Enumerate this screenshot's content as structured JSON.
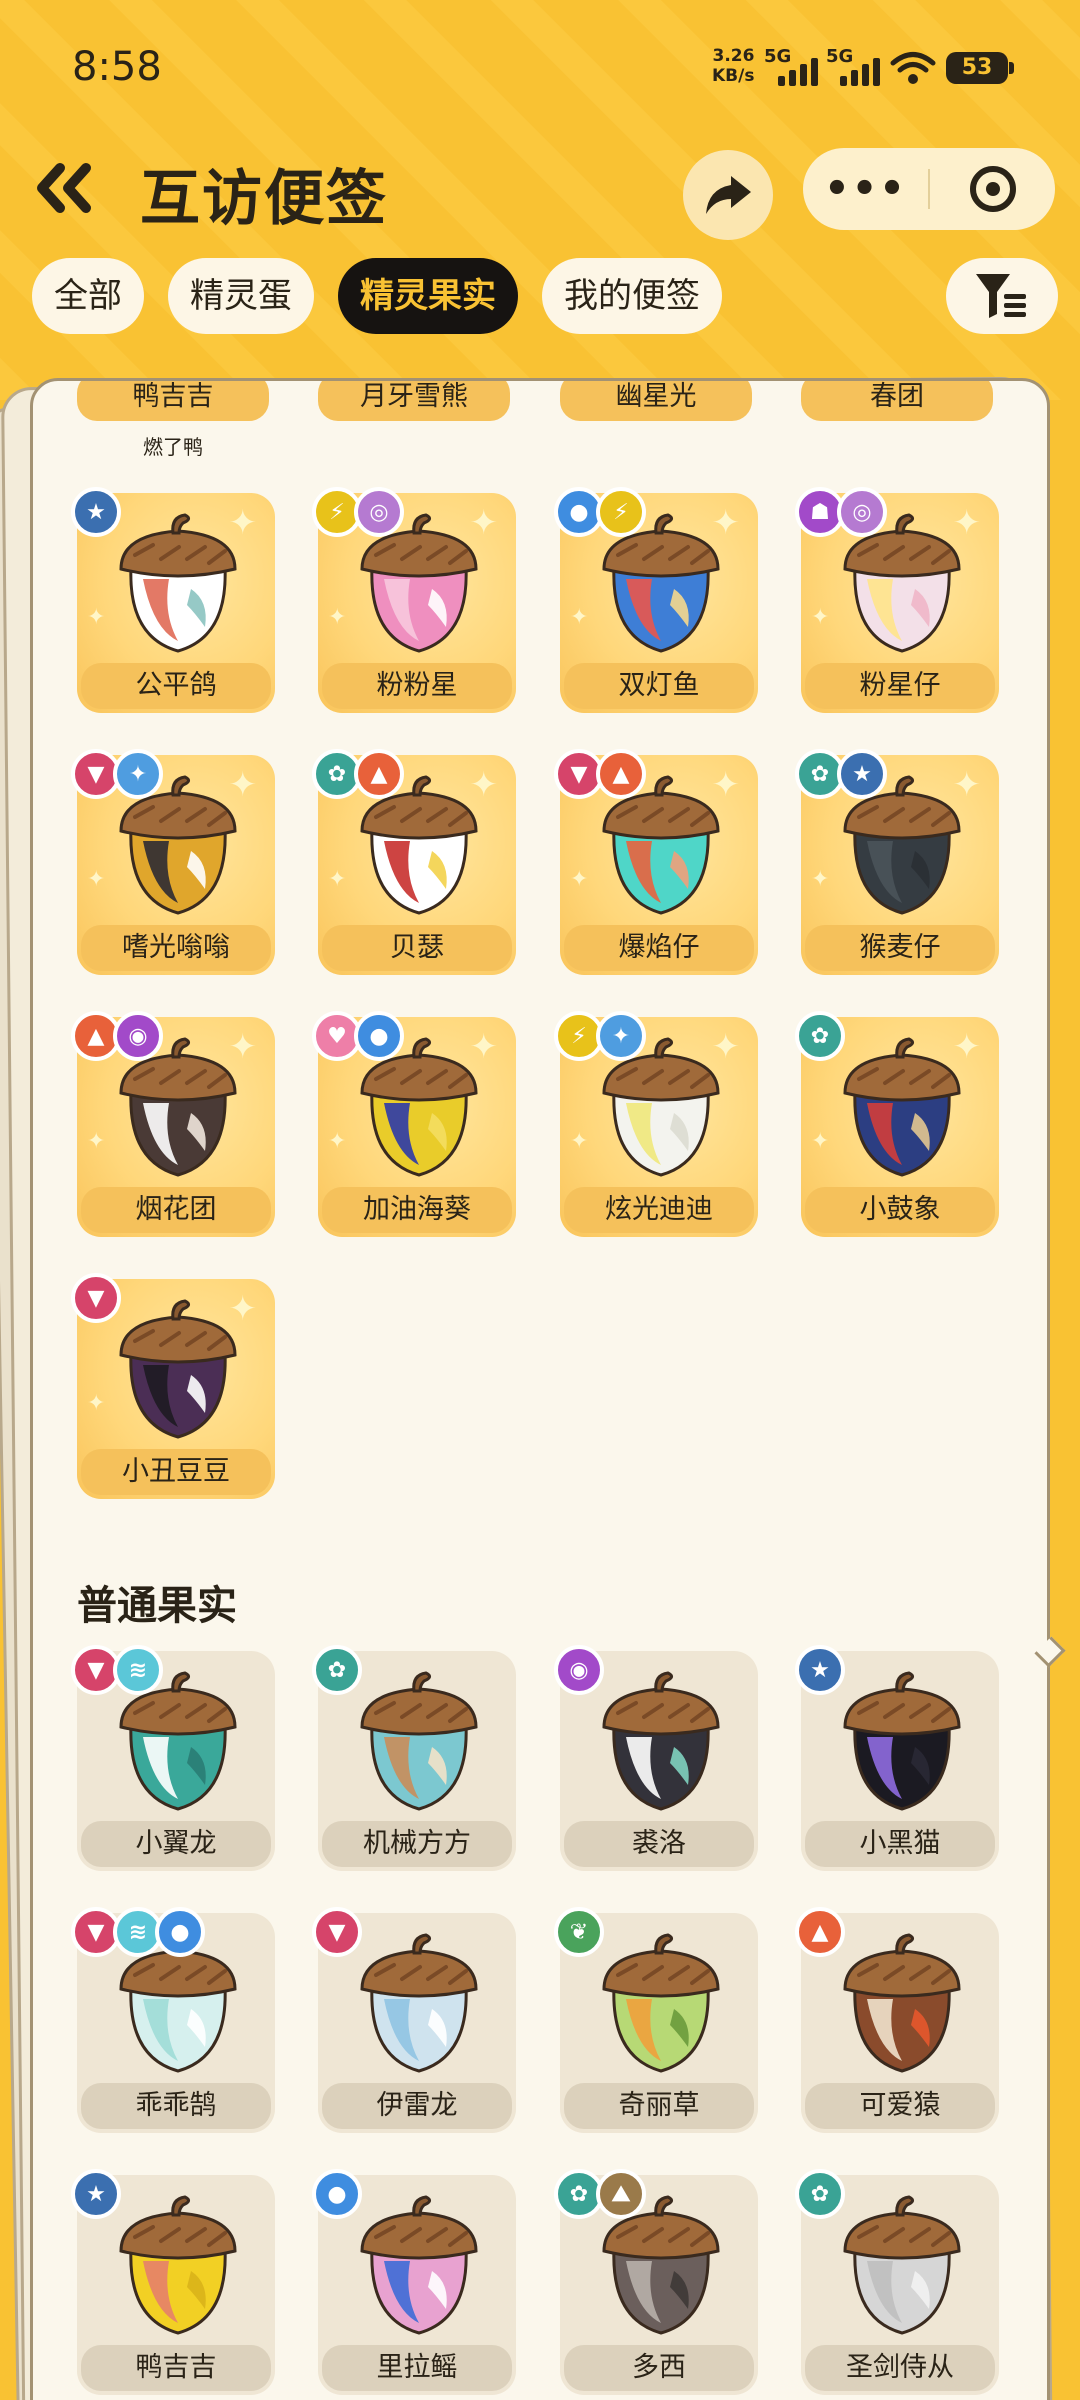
{
  "status_bar": {
    "time": "8:58",
    "net_speed_value": "3.26",
    "net_speed_unit": "KB/s",
    "sim1": "5G",
    "sim2": "5G",
    "battery": "53"
  },
  "header": {
    "title": "互访便签",
    "more_label": "•••",
    "icons": {
      "back": "double-chevron-left-icon",
      "share": "share-arrow-icon",
      "close": "target-close-icon"
    }
  },
  "tabs": [
    {
      "label": "全部",
      "active": false
    },
    {
      "label": "精灵蛋",
      "active": false
    },
    {
      "label": "精灵果实",
      "active": true
    },
    {
      "label": "我的便签",
      "active": false
    }
  ],
  "top_row": {
    "names": [
      "鸭吉吉",
      "月牙雪熊",
      "幽星光",
      "春团"
    ],
    "owner": "燃了鸭"
  },
  "special_fruits": [
    {
      "name": "公平鸽",
      "badges": [
        {
          "icon": "star-icon",
          "color": "#3b6fb0"
        }
      ],
      "colors": [
        "#ffffff",
        "#e06a55",
        "#8bc3c0"
      ]
    },
    {
      "name": "粉粉星",
      "badges": [
        {
          "icon": "lightning-icon",
          "color": "#e8c21a"
        },
        {
          "icon": "spiral-icon",
          "color": "#b57ad1"
        }
      ],
      "colors": [
        "#ef8fbf",
        "#f7c8dd",
        "#ffffff"
      ]
    },
    {
      "name": "双灯鱼",
      "badges": [
        {
          "icon": "water-drop-icon",
          "color": "#3f8de0"
        },
        {
          "icon": "lightning-icon",
          "color": "#e8c21a"
        }
      ],
      "colors": [
        "#3e7ed6",
        "#e9564c",
        "#f5d88d"
      ]
    },
    {
      "name": "粉星仔",
      "badges": [
        {
          "icon": "ghost-icon",
          "color": "#a24ac9"
        },
        {
          "icon": "spiral-icon",
          "color": "#b57ad1"
        }
      ],
      "colors": [
        "#f3e0e8",
        "#ffe48a",
        "#f0b6c8"
      ]
    },
    {
      "name": "嗜光嗡嗡",
      "badges": [
        {
          "icon": "demon-icon",
          "color": "#d6446a"
        },
        {
          "icon": "sparkle-icon",
          "color": "#4f9de0"
        }
      ],
      "colors": [
        "#e0a62c",
        "#2d2b33",
        "#ffffff"
      ]
    },
    {
      "name": "贝瑟",
      "badges": [
        {
          "icon": "gear-icon",
          "color": "#3aa395"
        },
        {
          "icon": "fire-icon",
          "color": "#e8613a"
        }
      ],
      "colors": [
        "#ffffff",
        "#c8302e",
        "#f3d24a"
      ]
    },
    {
      "name": "爆焰仔",
      "badges": [
        {
          "icon": "demon-icon",
          "color": "#d6446a"
        },
        {
          "icon": "fire-icon",
          "color": "#e8613a"
        }
      ],
      "colors": [
        "#4fd6c8",
        "#e8633e",
        "#f0a07a"
      ]
    },
    {
      "name": "猴麦仔",
      "badges": [
        {
          "icon": "gear-icon",
          "color": "#3aa395"
        },
        {
          "icon": "star-icon",
          "color": "#3b6fb0"
        }
      ],
      "colors": [
        "#353c42",
        "#4a535a",
        "#2a2f34"
      ]
    },
    {
      "name": "烟花团",
      "badges": [
        {
          "icon": "fire-icon",
          "color": "#e8613a"
        },
        {
          "icon": "search-swirl-icon",
          "color": "#a24ac9"
        }
      ],
      "colors": [
        "#4a3a36",
        "#ffffff",
        "#f0e6dc"
      ]
    },
    {
      "name": "加油海葵",
      "badges": [
        {
          "icon": "heart-icon",
          "color": "#ee7fa8"
        },
        {
          "icon": "water-drop-icon",
          "color": "#3f8de0"
        }
      ],
      "colors": [
        "#e9cc2a",
        "#2c3aa8",
        "#f4de60"
      ]
    },
    {
      "name": "炫光迪迪",
      "badges": [
        {
          "icon": "lightning-icon",
          "color": "#e8c21a"
        },
        {
          "icon": "sparkle-icon",
          "color": "#4f9de0"
        }
      ],
      "colors": [
        "#f3f3ee",
        "#f0e87a",
        "#dcdcd0"
      ]
    },
    {
      "name": "小鼓象",
      "badges": [
        {
          "icon": "gear-icon",
          "color": "#3aa395"
        }
      ],
      "colors": [
        "#2c3e82",
        "#d23d3a",
        "#e3c690"
      ]
    },
    {
      "name": "小丑豆豆",
      "badges": [
        {
          "icon": "demon-icon",
          "color": "#d6446a"
        }
      ],
      "colors": [
        "#4b2e55",
        "#1e1b22",
        "#ffffff"
      ]
    }
  ],
  "normal_section": {
    "title": "普通果实",
    "fruits": [
      {
        "name": "小翼龙",
        "badges": [
          {
            "icon": "demon-icon",
            "color": "#d6446a"
          },
          {
            "icon": "wind-icon",
            "color": "#5bc7d8"
          }
        ],
        "colors": [
          "#3aa89a",
          "#ffffff",
          "#2a7c74"
        ]
      },
      {
        "name": "机械方方",
        "badges": [
          {
            "icon": "gear-icon",
            "color": "#3aa395"
          }
        ],
        "colors": [
          "#7cc8d0",
          "#c98d5a",
          "#f2e2c8"
        ]
      },
      {
        "name": "裘洛",
        "badges": [
          {
            "icon": "search-swirl-icon",
            "color": "#a24ac9"
          }
        ],
        "colors": [
          "#33323a",
          "#ffffff",
          "#7fd2c0"
        ]
      },
      {
        "name": "小黑猫",
        "badges": [
          {
            "icon": "star-icon",
            "color": "#3b6fb0"
          }
        ],
        "colors": [
          "#1b1a22",
          "#8f6be0",
          "#2a2935"
        ]
      },
      {
        "name": "乖乖鹄",
        "badges": [
          {
            "icon": "demon-icon",
            "color": "#d6446a"
          },
          {
            "icon": "wind-icon",
            "color": "#5bc7d8"
          },
          {
            "icon": "water-drop-icon",
            "color": "#3f8de0"
          }
        ],
        "colors": [
          "#d6f0ee",
          "#9fdcd6",
          "#ffffff"
        ]
      },
      {
        "name": "伊雷龙",
        "badges": [
          {
            "icon": "demon-icon",
            "color": "#d6446a"
          }
        ],
        "colors": [
          "#cfe3ee",
          "#8fc3e2",
          "#ffffff"
        ]
      },
      {
        "name": "奇丽草",
        "badges": [
          {
            "icon": "leaf-icon",
            "color": "#4aa35c"
          }
        ],
        "colors": [
          "#b7d975",
          "#f0a03c",
          "#6a9a3c"
        ]
      },
      {
        "name": "可爱猿",
        "badges": [
          {
            "icon": "fire-icon",
            "color": "#e8613a"
          }
        ],
        "colors": [
          "#8a4b2c",
          "#f0e2cc",
          "#e6582c"
        ]
      },
      {
        "name": "鸭吉吉",
        "badges": [
          {
            "icon": "star-icon",
            "color": "#3b6fb0"
          }
        ],
        "colors": [
          "#f2d024",
          "#e5806a",
          "#d9b21a"
        ]
      },
      {
        "name": "里拉鳐",
        "badges": [
          {
            "icon": "water-drop-icon",
            "color": "#3f8de0"
          }
        ],
        "colors": [
          "#e8a2d0",
          "#3e6bd6",
          "#ffffff"
        ]
      },
      {
        "name": "多西",
        "badges": [
          {
            "icon": "gear-icon",
            "color": "#3aa395"
          },
          {
            "icon": "mountain-icon",
            "color": "#9a7a4a"
          }
        ],
        "colors": [
          "#6b5f5c",
          "#b8b0aa",
          "#3e3836"
        ]
      },
      {
        "name": "圣剑侍从",
        "badges": [
          {
            "icon": "gear-icon",
            "color": "#3aa395"
          }
        ],
        "colors": [
          "#d6d6d6",
          "#bfbfbf",
          "#f2f2f2"
        ]
      }
    ]
  }
}
